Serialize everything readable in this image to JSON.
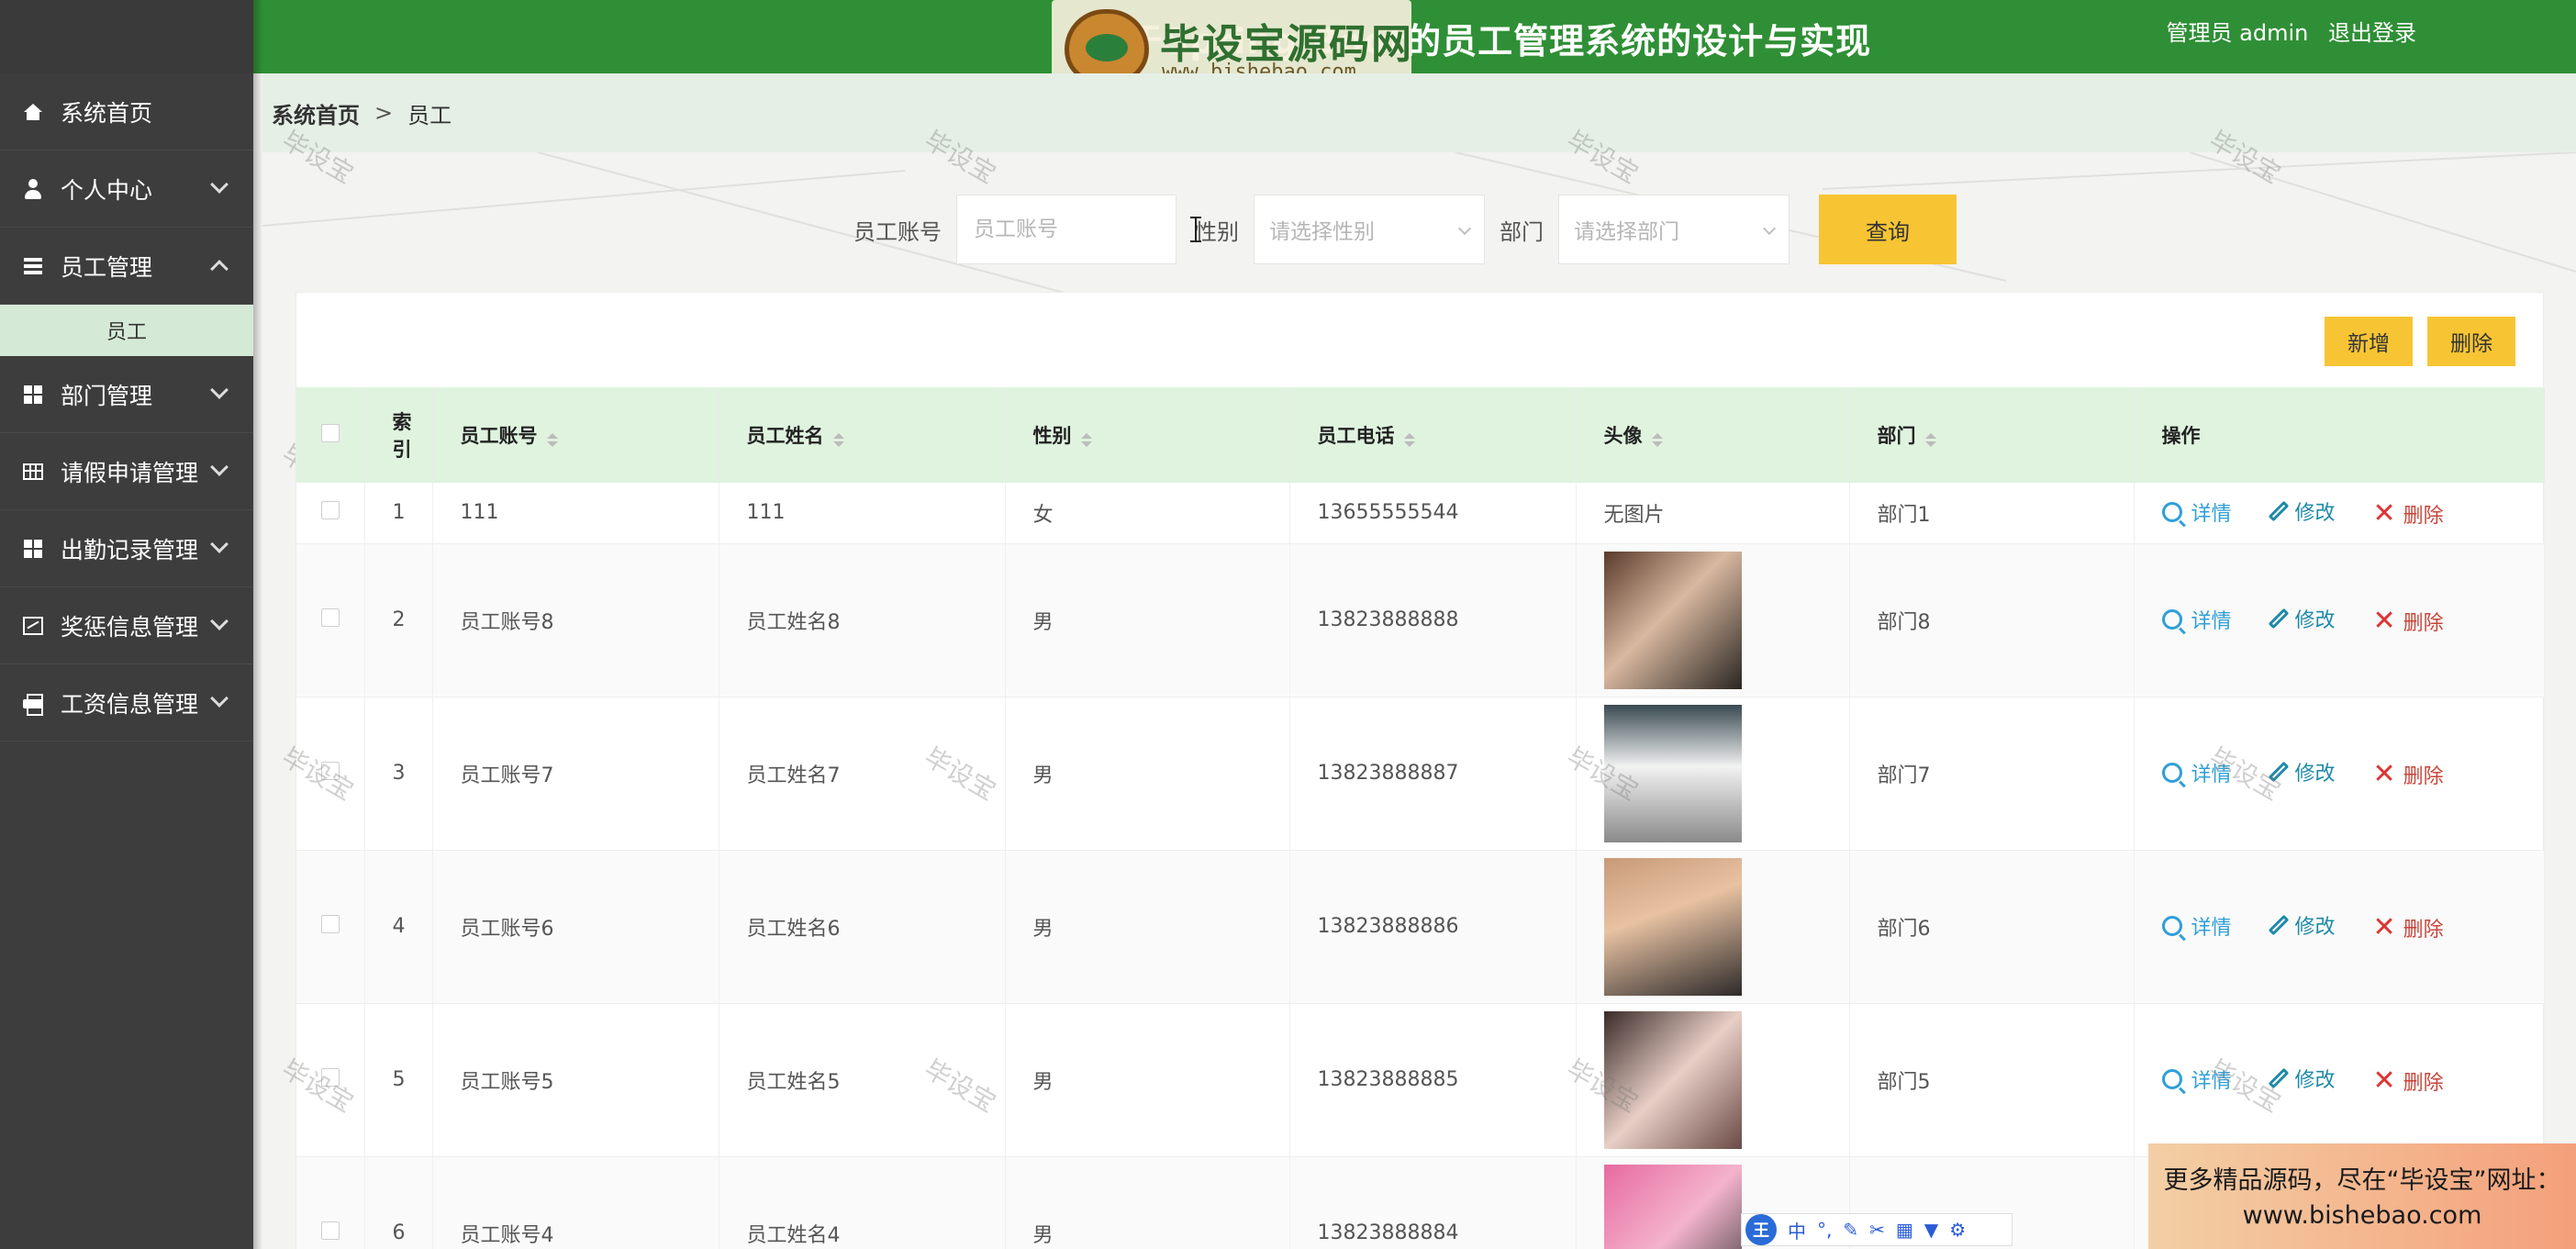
{
  "header": {
    "title": "基于Spring Boot的员工管理系统的设计与实现",
    "user_label": "管理员 admin",
    "logout_label": "退出登录"
  },
  "watermark_logo": {
    "name": "毕设宝源码网",
    "url": "www.bishebao.com"
  },
  "watermark_text": "毕设宝",
  "sidebar": {
    "items": [
      {
        "label": "系统首页",
        "icon": "home-icon"
      },
      {
        "label": "个人中心",
        "icon": "user-icon"
      },
      {
        "label": "员工管理",
        "icon": "list-icon",
        "expanded": true,
        "sub": "员工"
      },
      {
        "label": "部门管理",
        "icon": "grid-icon"
      },
      {
        "label": "请假申请管理",
        "icon": "table-icon"
      },
      {
        "label": "出勤记录管理",
        "icon": "grid-icon"
      },
      {
        "label": "奖惩信息管理",
        "icon": "chart-icon"
      },
      {
        "label": "工资信息管理",
        "icon": "print-icon"
      }
    ]
  },
  "breadcrumb": {
    "home": "系统首页",
    "separator": ">",
    "current": "员工"
  },
  "search": {
    "account_label": "员工账号",
    "account_placeholder": "员工账号",
    "gender_label": "性别",
    "gender_placeholder": "请选择性别",
    "dept_label": "部门",
    "dept_placeholder": "请选择部门",
    "query_button": "查询"
  },
  "toolbar": {
    "add_button": "新增",
    "delete_button": "删除"
  },
  "table": {
    "columns": [
      "索引",
      "员工账号",
      "员工姓名",
      "性别",
      "员工电话",
      "头像",
      "部门",
      "操作"
    ],
    "index_header_line1": "索",
    "index_header_line2": "引",
    "rows": [
      {
        "index": "1",
        "account": "111",
        "name": "111",
        "gender": "女",
        "phone": "13655555544",
        "avatar": "无图片",
        "dept": "部门1"
      },
      {
        "index": "2",
        "account": "员工账号8",
        "name": "员工姓名8",
        "gender": "男",
        "phone": "13823888888",
        "avatar": "photo",
        "dept": "部门8"
      },
      {
        "index": "3",
        "account": "员工账号7",
        "name": "员工姓名7",
        "gender": "男",
        "phone": "13823888887",
        "avatar": "photo",
        "dept": "部门7"
      },
      {
        "index": "4",
        "account": "员工账号6",
        "name": "员工姓名6",
        "gender": "男",
        "phone": "13823888886",
        "avatar": "photo",
        "dept": "部门6"
      },
      {
        "index": "5",
        "account": "员工账号5",
        "name": "员工姓名5",
        "gender": "男",
        "phone": "13823888885",
        "avatar": "photo",
        "dept": "部门5"
      },
      {
        "index": "6",
        "account": "员工账号4",
        "name": "员工姓名4",
        "gender": "男",
        "phone": "13823888884",
        "avatar": "photo",
        "dept": ""
      }
    ],
    "actions": {
      "detail": "详情",
      "edit": "修改",
      "delete": "删除"
    }
  },
  "ime": {
    "logo": "王",
    "mode": "中"
  },
  "ad": {
    "line1": "更多精品源码，尽在“毕设宝”网址：",
    "line2": "www.bishebao.com"
  },
  "colors": {
    "header_green": "#2f8f36",
    "sidebar_bg": "#3d3d3d",
    "accent_yellow": "#f7c533",
    "table_header_bg": "#dff3df"
  }
}
